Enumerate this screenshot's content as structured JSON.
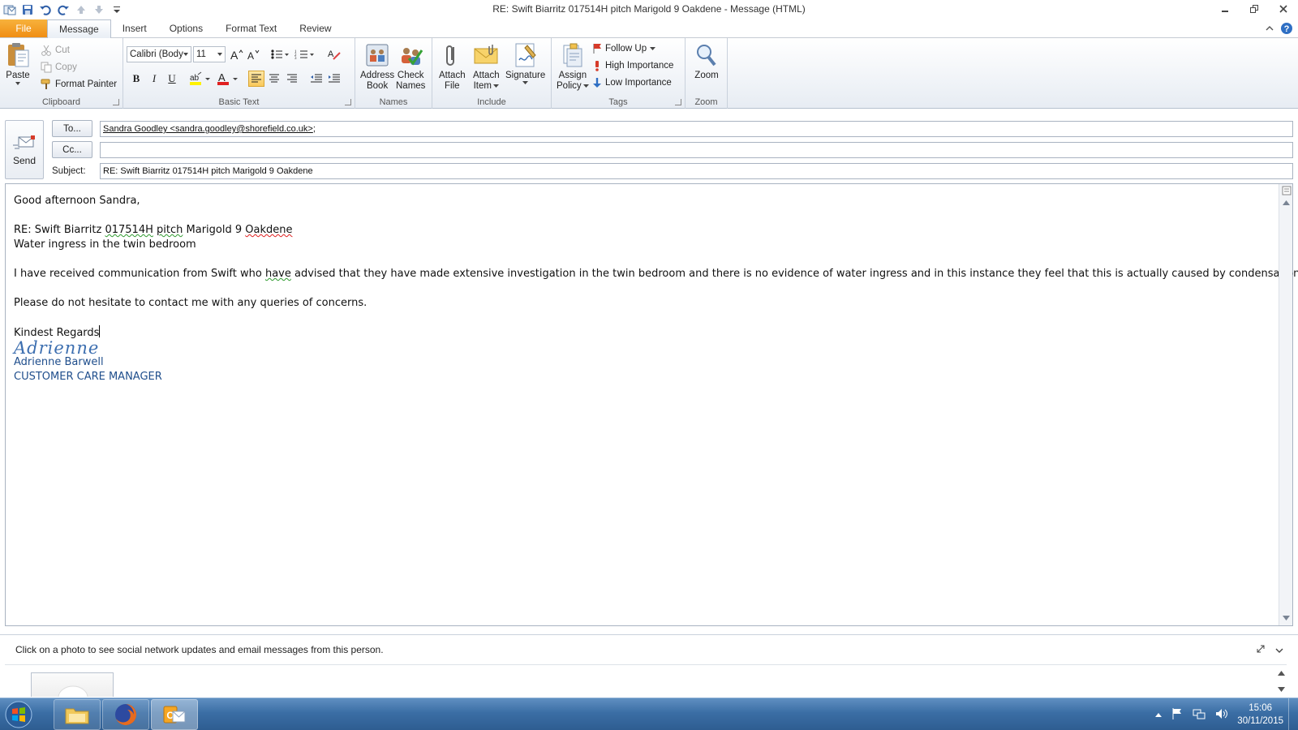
{
  "window": {
    "title": "RE: Swift Biarritz 017514H  pitch Marigold 9 Oakdene  -  Message (HTML)"
  },
  "tabs": [
    {
      "label": "File"
    },
    {
      "label": "Message"
    },
    {
      "label": "Insert"
    },
    {
      "label": "Options"
    },
    {
      "label": "Format Text"
    },
    {
      "label": "Review"
    }
  ],
  "ribbon": {
    "clipboard": {
      "label": "Clipboard",
      "paste": "Paste",
      "cut": "Cut",
      "copy": "Copy",
      "format_painter": "Format Painter"
    },
    "basic_text": {
      "label": "Basic Text",
      "font": "Calibri (Body)",
      "size": "11"
    },
    "names": {
      "label": "Names",
      "address_book_1": "Address",
      "address_book_2": "Book",
      "check_names_1": "Check",
      "check_names_2": "Names"
    },
    "include": {
      "label": "Include",
      "attach_file_1": "Attach",
      "attach_file_2": "File",
      "attach_item_1": "Attach",
      "attach_item_2": "Item",
      "signature": "Signature"
    },
    "tags": {
      "label": "Tags",
      "assign_policy_1": "Assign",
      "assign_policy_2": "Policy",
      "follow_up": "Follow Up",
      "high_importance": "High Importance",
      "low_importance": "Low Importance"
    },
    "zoom": {
      "label": "Zoom",
      "zoom": "Zoom"
    }
  },
  "compose": {
    "send": "Send",
    "to_button": "To...",
    "cc_button": "Cc...",
    "subject_label": "Subject:",
    "to_value": "Sandra Goodley <sandra.goodley@shorefield.co.uk>",
    "to_suffix": ";",
    "cc_value": "",
    "subject_value": "RE: Swift Biarritz 017514H  pitch Marigold 9 Oakdene"
  },
  "body": {
    "greeting": "Good afternoon Sandra,",
    "re_prefix": "RE: Swift Biarritz ",
    "re_code": "017514H",
    "re_pitch": "pitch",
    "re_mid": " Marigold 9 ",
    "re_place": "Oakdene",
    "line_water": "Water ingress in the twin bedroom",
    "para1_a": "I have received communication from Swift who ",
    "para1_have": "have",
    "para1_b": " advised that they have made extensive investigation in the twin bedroom and there is no evidence of water ingress and in this instance they feel that this is actually caused by condensation.",
    "para2": "Please do not hesitate to contact me with any queries of concerns.",
    "closing": "Kindest Regards",
    "signature_script": "Adrienne",
    "signature_name": "Adrienne Barwell",
    "signature_title": "CUSTOMER CARE MANAGER"
  },
  "people_pane": {
    "hint": "Click on a photo to see social network updates and email messages from this person."
  },
  "taskbar": {
    "time": "15:06",
    "date": "30/11/2015"
  },
  "colors": {
    "file_tab": "#f08e14",
    "signature_blue": "#1f4e8c",
    "taskbar": "#3b6ea5"
  }
}
